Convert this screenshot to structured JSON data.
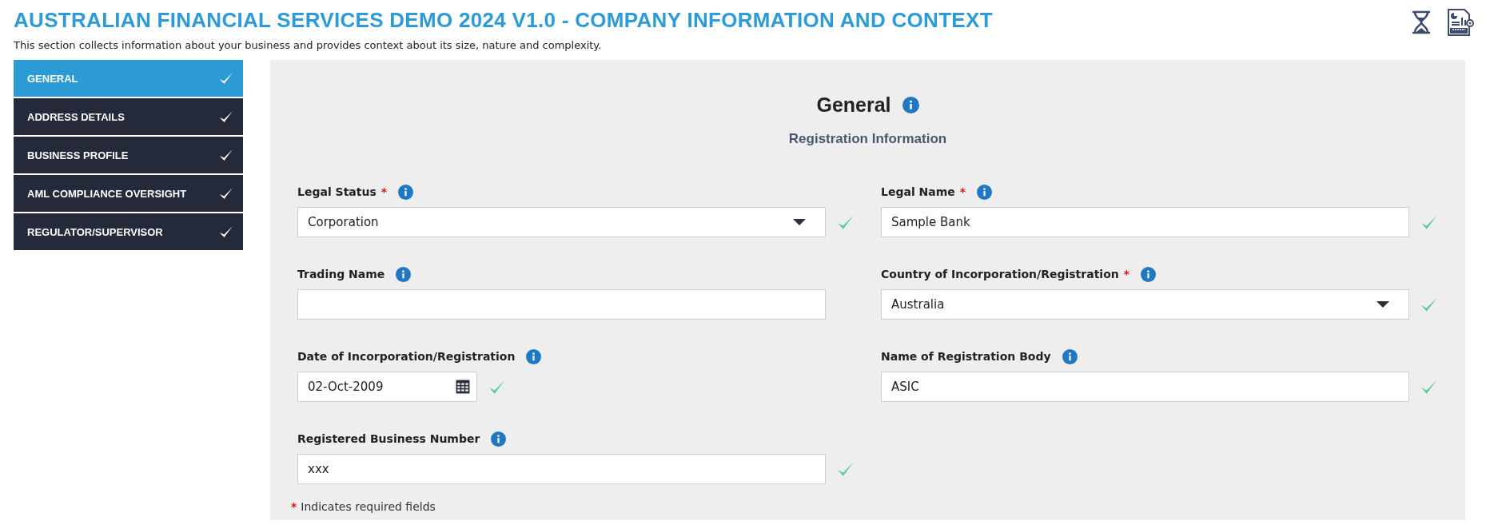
{
  "header": {
    "title": "AUSTRALIAN FINANCIAL SERVICES DEMO 2024 V1.0 - COMPANY INFORMATION AND CONTEXT",
    "description": "This section collects information about your business and provides context about its size, nature and complexity."
  },
  "sidebar": {
    "items": [
      {
        "label": "GENERAL",
        "selected": true,
        "complete": true
      },
      {
        "label": "ADDRESS DETAILS",
        "selected": false,
        "complete": true
      },
      {
        "label": "BUSINESS PROFILE",
        "selected": false,
        "complete": true
      },
      {
        "label": "AML COMPLIANCE OVERSIGHT",
        "selected": false,
        "complete": true
      },
      {
        "label": "REGULATOR/SUPERVISOR",
        "selected": false,
        "complete": true
      }
    ]
  },
  "form": {
    "title": "General",
    "subtitle": "Registration Information",
    "required_mark": "*",
    "fields": [
      {
        "kind": "select",
        "label": "Legal Status",
        "required": true,
        "value": "Corporation",
        "valid": true
      },
      {
        "kind": "text",
        "label": "Legal Name",
        "required": true,
        "value": "Sample Bank",
        "valid": true
      },
      {
        "kind": "text",
        "label": "Trading Name",
        "required": false,
        "valid": false
      },
      {
        "kind": "select",
        "label": "Country of Incorporation/Registration",
        "required": true,
        "value": "Australia",
        "valid": true
      },
      {
        "kind": "date",
        "label": "Date of Incorporation/Registration",
        "required": false,
        "value": "02-Oct-2009",
        "valid": true
      },
      {
        "kind": "text",
        "label": "Name of Registration Body",
        "required": false,
        "value": "ASIC",
        "valid": true
      },
      {
        "kind": "text",
        "label": "Registered Business Number",
        "required": false,
        "value": "xxx",
        "valid": true
      }
    ],
    "footnote": {
      "mark": "*",
      "text": "Indicates required fields"
    }
  }
}
